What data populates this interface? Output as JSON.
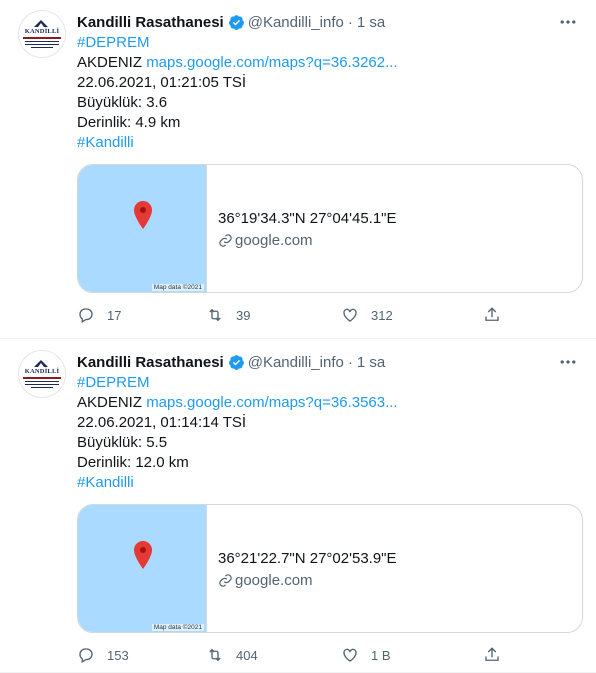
{
  "tweets": [
    {
      "author": "Kandilli Rasathanesi",
      "handle": "@Kandilli_info",
      "separator": "·",
      "time": "1 sa",
      "avatar": {
        "name": "KANDİLLİ",
        "verified": true
      },
      "hashtag_top": "#DEPREM",
      "region": "AKDENIZ",
      "map_link": "maps.google.com/maps?q=36.3262...",
      "datetime": "22.06.2021, 01:21:05 TSİ",
      "magnitude": "Büyüklük: 3.6",
      "depth": "Derinlik: 4.9 km",
      "hashtag_bottom": "#Kandilli",
      "card": {
        "coords": "36°19'34.3\"N 27°04'45.1\"E",
        "domain": "google.com",
        "map_data": "Map data ©2021"
      },
      "replies": "17",
      "retweets": "39",
      "likes": "312"
    },
    {
      "author": "Kandilli Rasathanesi",
      "handle": "@Kandilli_info",
      "separator": "·",
      "time": "1 sa",
      "avatar": {
        "name": "KANDİLLİ",
        "verified": true
      },
      "hashtag_top": "#DEPREM",
      "region": "AKDENIZ",
      "map_link": "maps.google.com/maps?q=36.3563...",
      "datetime": "22.06.2021, 01:14:14 TSİ",
      "magnitude": "Büyüklük: 5.5",
      "depth": "Derinlik: 12.0 km",
      "hashtag_bottom": "#Kandilli",
      "card": {
        "coords": "36°21'22.7\"N 27°02'53.9\"E",
        "domain": "google.com",
        "map_data": "Map data ©2021"
      },
      "replies": "153",
      "retweets": "404",
      "likes": "1 B"
    }
  ],
  "colors": {
    "link": "#1d9bf0",
    "muted": "#536471",
    "map": "#aadaff",
    "pin": "#e53935",
    "verified": "#1d9bf0"
  }
}
